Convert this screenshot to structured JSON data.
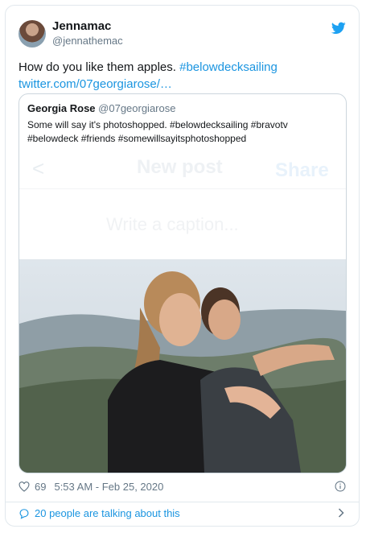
{
  "author": {
    "name": "Jennamac",
    "handle": "@jennathemac"
  },
  "tweet": {
    "text": "How do you like them apples. ",
    "hashtag": "#belowdecksailing",
    "link": "twitter.com/07georgiarose/…"
  },
  "quote": {
    "name": "Georgia Rose",
    "handle": "@07georgiarose",
    "text": "Some will say it's photoshopped. #belowdecksailing #bravotv #belowdeck #friends #somewillsayitsphotoshopped",
    "overlay": {
      "back": "<",
      "title": "New post",
      "share": "Share",
      "caption": "Write a caption..."
    }
  },
  "stats": {
    "likes": "69",
    "timestamp": "5:53 AM - Feb 25, 2020"
  },
  "footer": {
    "talking": "20 people are talking about this"
  },
  "colors": {
    "link": "#1b95e0",
    "twitter": "#1da1f2",
    "muted": "#657786"
  },
  "icons": [
    "twitter-logo-icon",
    "heart-icon",
    "info-icon",
    "speech-bubble-icon",
    "chevron-right-icon"
  ]
}
